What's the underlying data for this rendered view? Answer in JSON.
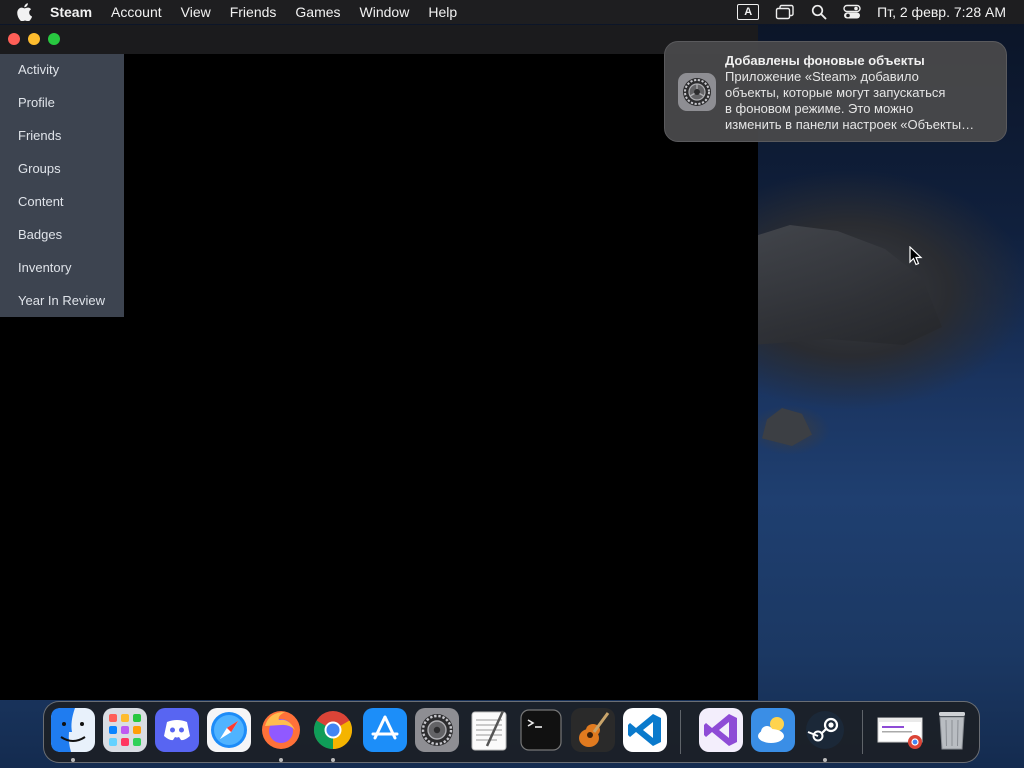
{
  "menubar": {
    "items": [
      "Steam",
      "Account",
      "View",
      "Friends",
      "Games",
      "Window",
      "Help"
    ],
    "input_indicator": "A",
    "clock": "Пт, 2 февр.  7:28 AM"
  },
  "profile_menu": {
    "items": [
      "Activity",
      "Profile",
      "Friends",
      "Groups",
      "Content",
      "Badges",
      "Inventory",
      "Year In Review"
    ]
  },
  "notification": {
    "title": "Добавлены фоновые объекты",
    "body": "Приложение «Steam» добавило\nобъекты, которые могут запускаться\nв фоновом режиме. Это можно\nизменить в панели настроек «Объекты…",
    "icon": "system-settings-icon"
  },
  "dock": {
    "apps": [
      {
        "name": "finder",
        "running": true
      },
      {
        "name": "launchpad",
        "running": false
      },
      {
        "name": "discord",
        "running": false
      },
      {
        "name": "safari",
        "running": false
      },
      {
        "name": "firefox",
        "running": true
      },
      {
        "name": "chrome",
        "running": true
      },
      {
        "name": "app-store",
        "running": false
      },
      {
        "name": "system-settings",
        "running": false
      },
      {
        "name": "textedit",
        "running": false
      },
      {
        "name": "terminal",
        "running": false
      },
      {
        "name": "garageband",
        "running": false
      },
      {
        "name": "vscode",
        "running": false
      },
      {
        "name": "visual-studio",
        "running": false
      },
      {
        "name": "weather",
        "running": false
      },
      {
        "name": "steam",
        "running": true
      },
      {
        "name": "chrome-document",
        "running": false
      },
      {
        "name": "trash",
        "running": false
      }
    ]
  },
  "colors": {
    "menubar_bg": "#1e1e20",
    "profile_menu_bg": "#3d4450",
    "notification_bg": "#48484a"
  }
}
